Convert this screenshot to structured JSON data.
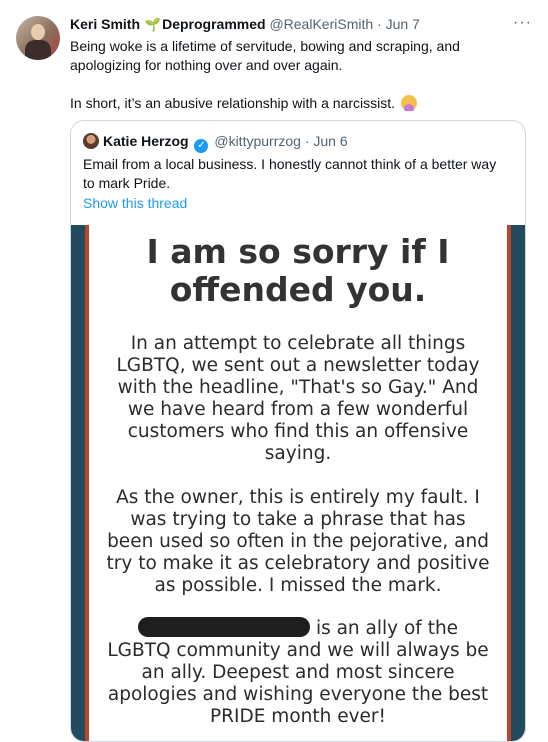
{
  "tweet": {
    "author_name": "Keri Smith",
    "sprout": "🌱",
    "author_label": "Deprogrammed",
    "handle": "@RealKeriSmith",
    "separator": "·",
    "date": "Jun 7",
    "more": "···",
    "text_line1": "Being woke is a lifetime of servitude, bowing and scraping, and apologizing for nothing over and over again.",
    "text_line2": "In short, it’s an abusive relationship with a narcissist.",
    "emoji_icon": "person-facepalming-icon"
  },
  "quote": {
    "author_name": "Katie Herzog",
    "verified_icon": "verified-badge-icon",
    "verified_glyph": "✓",
    "handle": "@kittypurrzog",
    "separator": "·",
    "date": "Jun 6",
    "text": "Email from a local business. I honestly cannot think of a better way to mark Pride.",
    "show_thread": "Show this thread"
  },
  "image": {
    "title": "I am so sorry if I offended you.",
    "paragraph1": "In an attempt to celebrate all things LGBTQ, we sent out a newsletter today with the headline, \"That's so Gay.\" And we have heard from a few wonderful customers who find this an offensive saying.",
    "paragraph2": "As the owner, this is entirely my fault. I was trying to take a phrase that has been used so often in the pejorative, and try to make it as celebratory and positive as possible. I missed the mark.",
    "paragraph3": "is an ally of the LGBTQ community and we will always be an ally. Deepest and most sincere apologies and wishing everyone the best PRIDE month ever!",
    "colors": {
      "stripe_blue": "#234b60",
      "stripe_red": "#b8462b"
    }
  },
  "colors": {
    "link": "#1d9bf0",
    "muted": "#536471",
    "text": "#0f1419"
  }
}
